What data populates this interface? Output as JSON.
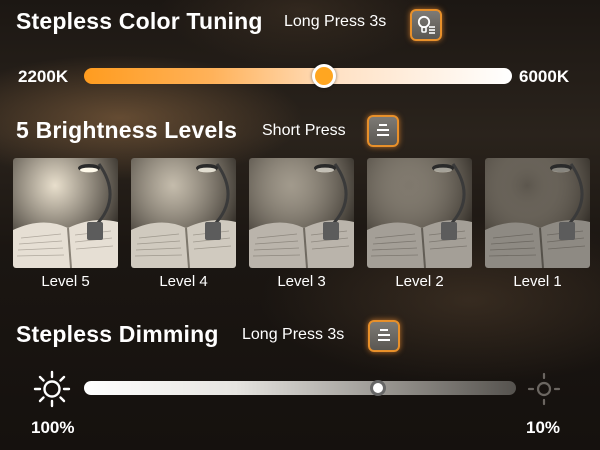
{
  "color_tuning": {
    "title": "Stepless Color Tuning",
    "hint": "Long Press 3s",
    "button_icon": "bulb-list-icon",
    "min_label": "2200K",
    "max_label": "6000K",
    "value_fraction": 0.56,
    "colors": {
      "warm": "#ff9c1f",
      "cool": "#ffffff",
      "accent": "#e8902a"
    }
  },
  "brightness_levels": {
    "title": "5 Brightness Levels",
    "hint": "Short Press",
    "button_icon": "menu-lines-icon",
    "levels": [
      {
        "label": "Level 5",
        "brightness": 1.0
      },
      {
        "label": "Level 4",
        "brightness": 0.8
      },
      {
        "label": "Level 3",
        "brightness": 0.6
      },
      {
        "label": "Level 2",
        "brightness": 0.4
      },
      {
        "label": "Level 1",
        "brightness": 0.2
      }
    ]
  },
  "dimming": {
    "title": "Stepless Dimming",
    "hint": "Long Press 3s",
    "button_icon": "menu-lines-icon",
    "max_icon": "sun-bright-icon",
    "min_icon": "sun-dim-icon",
    "max_label": "100%",
    "min_label": "10%",
    "value_fraction": 0.68
  }
}
